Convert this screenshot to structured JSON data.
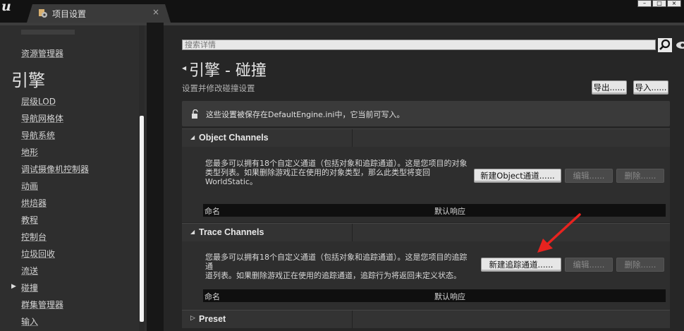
{
  "tab": {
    "label": "项目设置",
    "close": "×"
  },
  "window": {
    "buttons": [
      "–",
      "□",
      "×"
    ]
  },
  "sidebar": {
    "items_top": [
      "资源管理器"
    ],
    "category": "引擎",
    "items": [
      "层级LOD",
      "导航网格体",
      "导航系统",
      "地形",
      "调试摄像机控制器",
      "动画",
      "烘焙器",
      "教程",
      "控制台",
      "垃圾回收",
      "流送",
      "碰撞",
      "群集管理器",
      "输入"
    ],
    "selected": "碰撞"
  },
  "search": {
    "placeholder": "搜索详情"
  },
  "page": {
    "title": "引擎 - 碰撞",
    "subtitle": "设置并修改碰撞设置",
    "export_label": "导出......",
    "import_label": "导入......",
    "notice": "这些设置被保存在DefaultEngine.ini中，它当前可写入。"
  },
  "object_channels": {
    "header": "Object Channels",
    "desc_line1": "您最多可以拥有18个自定义通道（包括对象和追踪通道）。这是您项目的对象",
    "desc_line2": "类型列表。如果删除游戏正在使用的对象类型，那么此类型将变回",
    "desc_line3": "WorldStatic。",
    "new_label": "新建Object通道......",
    "edit_label": "编辑......",
    "delete_label": "删除......",
    "col_name": "命名",
    "col_response": "默认响应"
  },
  "trace_channels": {
    "header": "Trace Channels",
    "desc_line1": "您最多可以拥有18个自定义通道（包括对象和追踪通道）。这是您项目的追踪通",
    "desc_line2": "道列表。如果删除游戏正在使用的追踪通道，追踪行为将返回未定义状态。",
    "new_label": "新建追踪通道......",
    "edit_label": "编辑......",
    "delete_label": "删除......",
    "col_name": "命名",
    "col_response": "默认响应"
  },
  "preset": {
    "header": "Preset"
  },
  "colors": {
    "annotation_arrow": "#e8231f",
    "background": "#262626"
  }
}
